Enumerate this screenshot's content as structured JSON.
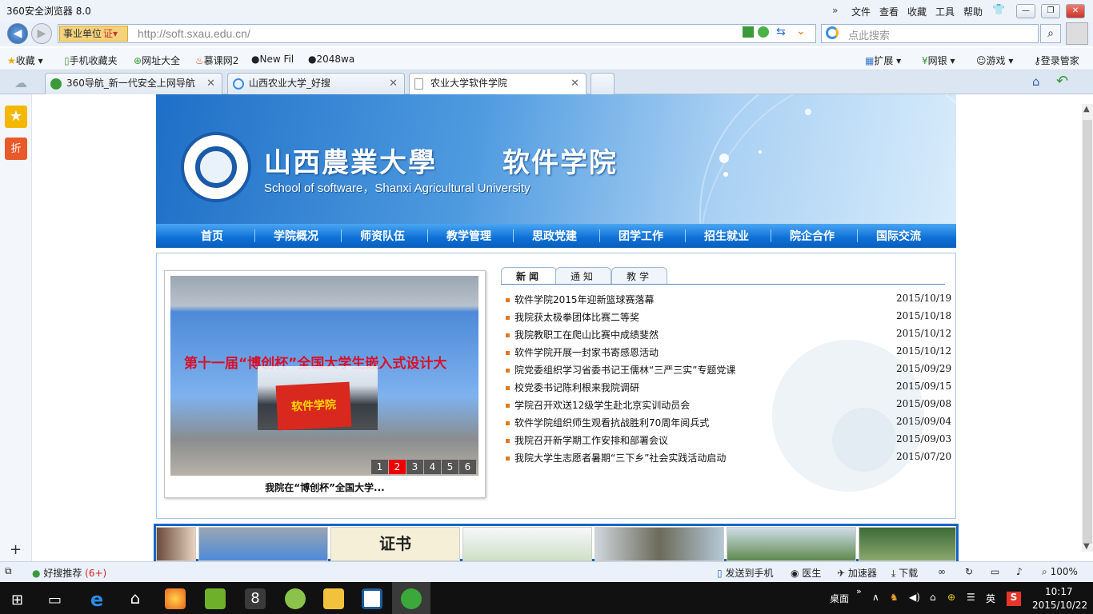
{
  "browser": {
    "title": "360安全浏览器 8.0",
    "menu": [
      "文件",
      "查看",
      "收藏",
      "工具",
      "帮助"
    ],
    "address_badge": "事业单位",
    "url": "http://soft.sxau.edu.cn/",
    "search_placeholder": "点此搜索",
    "bookmarks": [
      "收藏",
      "手机收藏夹",
      "网址大全",
      "慕课网2",
      "New Fil",
      "2048wa"
    ],
    "toolbar_right": [
      "扩展",
      "网银",
      "游戏",
      "登录管家"
    ],
    "tabs": [
      {
        "label": "360导航_新一代安全上网导航"
      },
      {
        "label": "山西农业大学_好搜"
      },
      {
        "label": "农业大学软件学院"
      }
    ]
  },
  "site": {
    "title_cn1": "山西農業大學",
    "title_cn2": "软件学院",
    "title_en": "School of software，Shanxi Agricultural University",
    "nav": [
      "首页",
      "学院概况",
      "师资队伍",
      "教学管理",
      "思政党建",
      "团学工作",
      "招生就业",
      "院企合作",
      "国际交流"
    ],
    "slide": {
      "banner_text": "第十一届“博创杯”全国大学生嵌入式设计大",
      "flag_text": "软件学院",
      "pages": [
        "1",
        "2",
        "3",
        "4",
        "5",
        "6"
      ],
      "caption": "我院在“博创杯”全国大学..."
    },
    "news_tabs": [
      "新闻",
      "通知",
      "教学"
    ],
    "news": [
      {
        "title": "软件学院2015年迎新篮球赛落幕",
        "date": "2015/10/19"
      },
      {
        "title": "我院获太极拳团体比赛二等奖",
        "date": "2015/10/18"
      },
      {
        "title": "我院教职工在爬山比赛中成绩斐然",
        "date": "2015/10/12"
      },
      {
        "title": "软件学院开展一封家书寄感恩活动",
        "date": "2015/10/12"
      },
      {
        "title": "院党委组织学习省委书记王儒林“三严三实”专题党课",
        "date": "2015/09/29"
      },
      {
        "title": "校党委书记陈利根来我院调研",
        "date": "2015/09/15"
      },
      {
        "title": "学院召开欢送12级学生赴北京实训动员会",
        "date": "2015/09/08"
      },
      {
        "title": "软件学院组织师生观看抗战胜利70周年阅兵式",
        "date": "2015/09/04"
      },
      {
        "title": "我院召开新学期工作安排和部署会议",
        "date": "2015/09/03"
      },
      {
        "title": "我院大学生志愿者暑期“三下乡”社会实践活动启动",
        "date": "2015/07/20"
      }
    ],
    "strip_cert_text": "证书"
  },
  "statusbar": {
    "recommend": "好搜推荐",
    "recommend_count": "(6+)",
    "items": [
      "发送到手机",
      "医生",
      "加速器",
      "下载"
    ],
    "zoom": "100%"
  },
  "taskbar": {
    "desktop": "桌面",
    "ime": "英",
    "time": "10:17",
    "date": "2015/10/22"
  }
}
